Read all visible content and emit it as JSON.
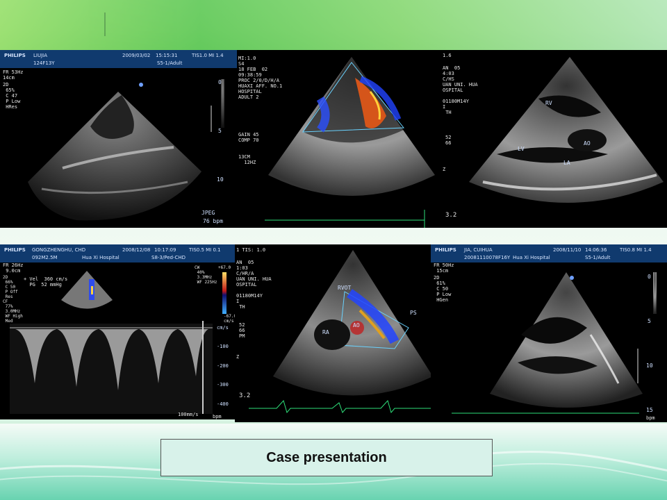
{
  "panels": {
    "p1": {
      "brand": "PHILIPS",
      "name": "LIUJIA",
      "id": "124F13Y",
      "date": "2009/03/02",
      "time": "15:15:31",
      "tis": "TIS1.0  MI 1.4",
      "probe": "S5-1/Adult",
      "fr": "FR 53Hz\n14cm",
      "settings": "2D\n 65%\n C 47\n P Low\n HRes",
      "scale": [
        "0",
        "5",
        "10"
      ],
      "bpm": "76 bpm",
      "jpeg": "JPEG"
    },
    "p2": {
      "header": "MI:1.0\nS4\n18 FEB  02\n09:38:59\nPROC 2/0/D/H/A\nHUAXI AFF. NO.1\nHOSPITAL\nADULT 2",
      "gain": "GAIN 45\nCOMP 70",
      "depth": "13CM\n  12HZ"
    },
    "p3": {
      "top": "1.6",
      "header": "AN  05\n4:03\nC/HS\nUAN UNI. HUA\nOSPITAL\n\n01180M14Y\nI\n TH",
      "nums": "52\n66",
      "z": "Z",
      "labels": [
        "RV",
        "AO",
        "LV",
        "LA"
      ],
      "bottom": "3.2"
    },
    "p4": {
      "brand": "PHILIPS",
      "name": "GONGZHENGHU, CHD",
      "id": "092M2.5M",
      "hospital": "Hua Xi Hospital",
      "date": "2008/12/08",
      "time": "10:17:09",
      "tis": "TIS0.5  MI 0.1",
      "probe": "S8-3/Ped-CHD",
      "fr": "FR 26Hz\n 9.0cm",
      "settings": "2D\n 66%\n C 50\n P Off\n Res\nCF\n 77%\n 3.0MHz\n WF High\n Med",
      "vel": "+ Vel  360 cm/s\n  PG  52 mmHg",
      "cw": "CW\n 40%\n 3.3MHz\n WF 225Hz",
      "cf_top": "+67.0",
      "cf_bot": "-67.0\ncm/s",
      "doppler_ticks": [
        "cm/s",
        "-100",
        "-200",
        "-300",
        "-400"
      ],
      "sweep": "100mm/s",
      "bpm": "bpm"
    },
    "p5": {
      "top": "1 TIS: 1.0",
      "header": "AN  05\n1:03\nC/HR/A\nUAN UNI. HUA\nOSPITAL\n\n01180M14Y\nI\n TH",
      "nums": "52\n66\nPM",
      "z": "Z",
      "labels": [
        "RVOT",
        "AO",
        "RA",
        "PS"
      ],
      "bottom": "3.2"
    },
    "p6": {
      "brand": "PHILIPS",
      "name": "JIA, CUIHUA",
      "id": "20081110078F16Y",
      "hospital": "Hua Xi Hospital",
      "date": "2008/11/10",
      "time": "14:06:36",
      "tis": "TIS0.8  MI 1.4",
      "probe": "S5-1/Adult",
      "fr": "FR 50Hz\n 15cm",
      "settings": "2D\n 61%\n C 50\n P Low\n HGen",
      "scale": [
        "0",
        "5",
        "10",
        "15"
      ],
      "bpm": "bpm"
    }
  },
  "caption": "Case presentation"
}
